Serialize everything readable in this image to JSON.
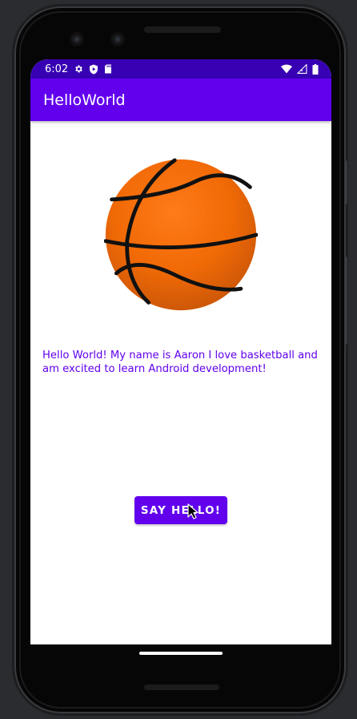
{
  "statusbar": {
    "time": "6:02",
    "left_icons": [
      "gear-icon",
      "shield-play-icon",
      "sdcard-icon"
    ],
    "right_icons": [
      "wifi-icon",
      "cellular-signal-icon",
      "battery-icon"
    ],
    "color": "#3700b3"
  },
  "appbar": {
    "title": "HelloWorld",
    "color": "#6200ee"
  },
  "main": {
    "image": "basketball-image",
    "message": "Hello World! My name is Aaron I love basketball and am excited to learn Android development!",
    "message_color": "#6200ee",
    "button_label": "SAY HELLO!",
    "button_color": "#6200ee"
  }
}
